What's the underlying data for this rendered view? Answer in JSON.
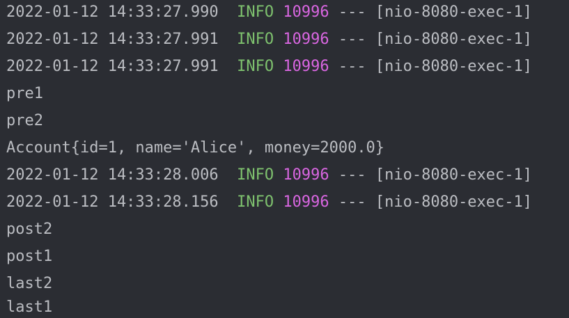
{
  "console": {
    "lines": [
      {
        "kind": "log",
        "timestamp": "2022-01-12 14:33:27.990",
        "level": "INFO",
        "pid": "10996",
        "sep": "---",
        "thread": "[nio-8080-exec-1]"
      },
      {
        "kind": "log",
        "timestamp": "2022-01-12 14:33:27.991",
        "level": "INFO",
        "pid": "10996",
        "sep": "---",
        "thread": "[nio-8080-exec-1]"
      },
      {
        "kind": "log",
        "timestamp": "2022-01-12 14:33:27.991",
        "level": "INFO",
        "pid": "10996",
        "sep": "---",
        "thread": "[nio-8080-exec-1]"
      },
      {
        "kind": "text",
        "text": "pre1"
      },
      {
        "kind": "text",
        "text": "pre2"
      },
      {
        "kind": "text",
        "text": "Account{id=1, name='Alice', money=2000.0}"
      },
      {
        "kind": "log",
        "timestamp": "2022-01-12 14:33:28.006",
        "level": "INFO",
        "pid": "10996",
        "sep": "---",
        "thread": "[nio-8080-exec-1]"
      },
      {
        "kind": "log",
        "timestamp": "2022-01-12 14:33:28.156",
        "level": "INFO",
        "pid": "10996",
        "sep": "---",
        "thread": "[nio-8080-exec-1]"
      },
      {
        "kind": "text",
        "text": "post2"
      },
      {
        "kind": "text",
        "text": "post1"
      },
      {
        "kind": "text",
        "text": "last2"
      },
      {
        "kind": "text",
        "text": "last1"
      }
    ]
  },
  "colors": {
    "background": "#2b2d33",
    "text": "#bbbdc2",
    "info_level": "#7ec16e",
    "pid": "#d866e0"
  }
}
